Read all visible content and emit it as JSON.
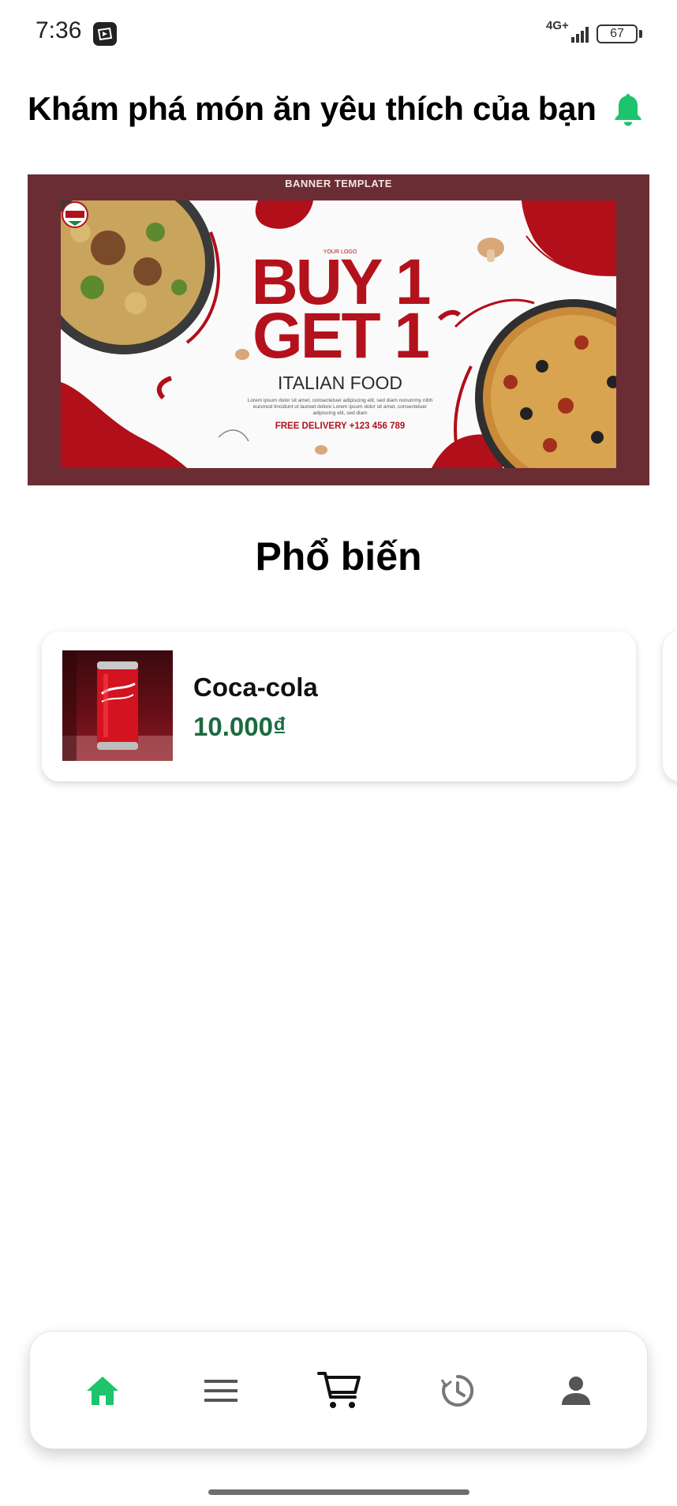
{
  "status_bar": {
    "time": "7:36",
    "network": "4G+",
    "battery": "67"
  },
  "header": {
    "title": "Khám phá món ăn yêu thích của bạn",
    "bell_icon": "bell-icon",
    "accent_color": "#1cc46b"
  },
  "banner": {
    "caption": "BANNER TEMPLATE",
    "logo_text": "YOUR LOGO",
    "logo_badge": "ITALIAN",
    "headline_line1": "BUY 1",
    "headline_line2": "GET 1",
    "subheadline": "ITALIAN FOOD",
    "body": "Lorem ipsum dolor sit amet, consectetuer adipiscing elit, sed diam nonummy nibh euismod tincidunt ut laoreet dolore Lorem ipsum dolor sit amet, consectetuer adipiscing elit, sed diam",
    "delivery": "FREE DELIVERY +123 456 789"
  },
  "popular": {
    "title": "Phổ biến",
    "items": [
      {
        "name": "Coca-cola",
        "price": "10.000₫",
        "image": "coca-cola-can"
      }
    ]
  },
  "bottom_nav": {
    "items": [
      {
        "icon": "home-icon",
        "active": true
      },
      {
        "icon": "menu-icon",
        "active": false
      },
      {
        "icon": "cart-icon",
        "active": false
      },
      {
        "icon": "history-icon",
        "active": false
      },
      {
        "icon": "user-icon",
        "active": false
      }
    ],
    "active_color": "#1cc46b",
    "inactive_color": "#555555"
  }
}
